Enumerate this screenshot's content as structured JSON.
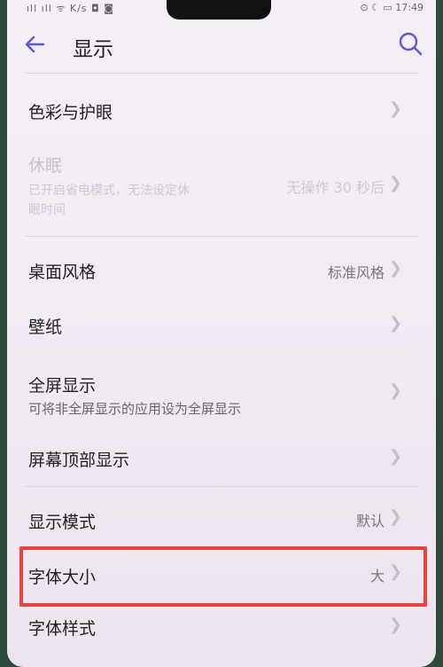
{
  "statusbar": {
    "left_text": "ıll ıll ᯤ K/s ◘ ◙",
    "right_text": "⊙ ☾ ▭ 17:49"
  },
  "header": {
    "title": "显示"
  },
  "items": [
    {
      "label": "色彩与护眼",
      "value": "",
      "sub": "",
      "disabled": false
    },
    {
      "label": "休眠",
      "value": "无操作 30 秒后",
      "sub_lines": [
        "已开启省电模式，无法设定休",
        "眠时间"
      ],
      "disabled": true
    },
    {
      "label": "桌面风格",
      "value": "标准风格",
      "sub": "",
      "disabled": false
    },
    {
      "label": "壁纸",
      "value": "",
      "sub": "",
      "disabled": false
    },
    {
      "label": "全屏显示",
      "value": "",
      "sub": "可将非全屏显示的应用设为全屏显示",
      "disabled": false
    },
    {
      "label": "屏幕顶部显示",
      "value": "",
      "sub": "",
      "disabled": false
    },
    {
      "label": "显示模式",
      "value": "默认",
      "sub": "",
      "disabled": false
    },
    {
      "label": "字体大小",
      "value": "大",
      "sub": "",
      "disabled": false
    },
    {
      "label": "字体样式",
      "value": "",
      "sub": "",
      "disabled": false
    }
  ],
  "colors": {
    "accent": "#5a5ad6",
    "highlight": "#e8413f"
  },
  "icons": {
    "back": "arrow-left-icon",
    "search": "search-icon",
    "chevron": "chevron-right-icon"
  }
}
